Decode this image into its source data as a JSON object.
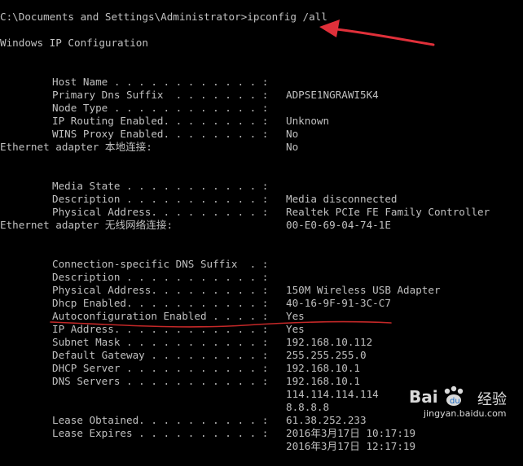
{
  "console": {
    "command_line": "C:\\Documents and Settings\\Administrator>ipconfig /all",
    "title": "Windows IP Configuration",
    "global": [
      {
        "label": "Host Name . . . . . . . . . . . . :",
        "value": "ADPSE1NGRAWI5K4"
      },
      {
        "label": "Primary Dns Suffix  . . . . . . . :",
        "value": ""
      },
      {
        "label": "Node Type . . . . . . . . . . . . :",
        "value": "Unknown"
      },
      {
        "label": "IP Routing Enabled. . . . . . . . :",
        "value": "No"
      },
      {
        "label": "WINS Proxy Enabled. . . . . . . . :",
        "value": "No"
      }
    ],
    "adapter1": {
      "header": "Ethernet adapter 本地连接:",
      "rows": [
        {
          "label": "Media State . . . . . . . . . . . :",
          "value": "Media disconnected"
        },
        {
          "label": "Description . . . . . . . . . . . :",
          "value": "Realtek PCIe FE Family Controller"
        },
        {
          "label": "Physical Address. . . . . . . . . :",
          "value": "00-E0-69-04-74-1E"
        }
      ]
    },
    "adapter2": {
      "header": "Ethernet adapter 无线网络连接:",
      "rows": [
        {
          "label": "Connection-specific DNS Suffix  . :",
          "value": ""
        },
        {
          "label": "Description . . . . . . . . . . . :",
          "value": "150M Wireless USB Adapter"
        },
        {
          "label": "Physical Address. . . . . . . . . :",
          "value": "40-16-9F-91-3C-C7"
        },
        {
          "label": "Dhcp Enabled. . . . . . . . . . . :",
          "value": "Yes"
        },
        {
          "label": "Autoconfiguration Enabled . . . . :",
          "value": "Yes"
        },
        {
          "label": "IP Address. . . . . . . . . . . . :",
          "value": "192.168.10.112"
        },
        {
          "label": "Subnet Mask . . . . . . . . . . . :",
          "value": "255.255.255.0"
        },
        {
          "label": "Default Gateway . . . . . . . . . :",
          "value": "192.168.10.1"
        },
        {
          "label": "DHCP Server . . . . . . . . . . . :",
          "value": "192.168.10.1"
        },
        {
          "label": "DNS Servers . . . . . . . . . . . :",
          "value": "114.114.114.114"
        },
        {
          "label": "",
          "value": "8.8.8.8"
        },
        {
          "label": "",
          "value": "61.38.252.233"
        },
        {
          "label": "Lease Obtained. . . . . . . . . . :",
          "value": "2016年3月17日 10:17:19"
        },
        {
          "label": "Lease Expires . . . . . . . . . . :",
          "value": "2016年3月17日 12:17:19"
        }
      ]
    }
  },
  "watermark": {
    "brand": "Bai",
    "brand_suffix": "经验",
    "url": "jingyan.baidu.com"
  },
  "colors": {
    "background": "#000000",
    "text": "#c0c0c0",
    "annotation": "#e0303a"
  }
}
